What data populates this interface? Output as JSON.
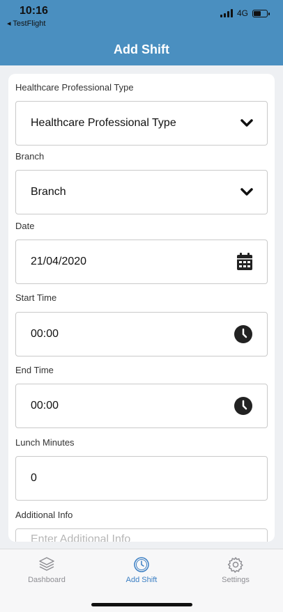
{
  "status_bar": {
    "time": "10:16",
    "back_app": "TestFlight",
    "network": "4G",
    "battery_level": 0.6
  },
  "header": {
    "title": "Add Shift"
  },
  "form": {
    "healthcare_type": {
      "label": "Healthcare Professional Type",
      "value": "Healthcare Professional Type"
    },
    "branch": {
      "label": "Branch",
      "value": "Branch"
    },
    "date": {
      "label": "Date",
      "value": "21/04/2020"
    },
    "start_time": {
      "label": "Start Time",
      "value": "00:00"
    },
    "end_time": {
      "label": "End Time",
      "value": "00:00"
    },
    "lunch_minutes": {
      "label": "Lunch Minutes",
      "value": "0"
    },
    "additional_info": {
      "label": "Additional Info",
      "placeholder": "Enter Additional Info"
    }
  },
  "tabs": [
    {
      "label": "Dashboard",
      "icon": "layers-icon",
      "active": false
    },
    {
      "label": "Add Shift",
      "icon": "clock-icon",
      "active": true
    },
    {
      "label": "Settings",
      "icon": "gear-icon",
      "active": false
    }
  ],
  "colors": {
    "header": "#4a8fc0",
    "accent": "#3a7ec3"
  }
}
